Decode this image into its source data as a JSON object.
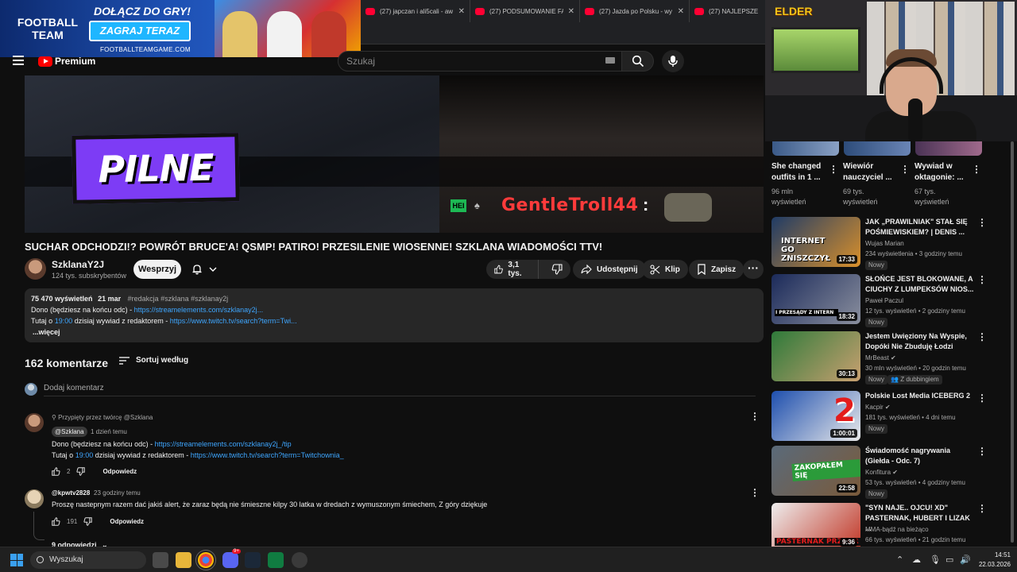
{
  "ad": {
    "brand_line1": "FOOTBALL",
    "brand_line2": "TEAM",
    "join": "DOŁĄCZ DO GRY!",
    "play": "ZAGRAJ TERAZ",
    "url": "FOOTBALLTEAMGAME.COM"
  },
  "browser": {
    "tabs": [
      {
        "title": "(27) japczan i ali5cali - aw"
      },
      {
        "title": "(27) PODSUMOWANIE FA"
      },
      {
        "title": "(27) Jazda po Polsku - wy"
      },
      {
        "title": "(27) NAJLEPSZE MOME"
      }
    ]
  },
  "header": {
    "logo": "Premium",
    "search_placeholder": "Szukaj"
  },
  "player": {
    "overlay_text": "PILNE",
    "chat_badge": "HEI",
    "chat_user": "GentleTroll44",
    "chat_colon": ":"
  },
  "webcam": {
    "brand": "ELDER"
  },
  "video": {
    "title": "SUCHAR ODCHODZI!? POWRÓT BRUCE'A! QSMP! PATIRO! PRZESILENIE WIOSENNE! SZKLANA WIADOMOŚCI TTV!",
    "channel": "SzklanaY2J",
    "subscribers": "124 tys. subskrybentów",
    "support_label": "Wesprzyj",
    "likes": "3,1 tys.",
    "share_label": "Udostępnij",
    "clip_label": "Klip",
    "save_label": "Zapisz"
  },
  "description": {
    "views": "75 470 wyświetleń",
    "date": "21 mar",
    "tags": "#redakcja #szklana #szklanay2j",
    "line1_prefix": "Dono (będziesz na końcu odc) - ",
    "line1_link": "https://streamelements.com/szklanay2j...",
    "line2_prefix": "Tutaj o ",
    "line2_time": "19:00",
    "line2_mid": " dzisiaj wywiad z redaktorem - ",
    "line2_link": "https://www.twitch.tv/search?term=Twi...",
    "more": "...więcej"
  },
  "comments": {
    "count": "162 komentarze",
    "sort_label": "Sortuj według",
    "add_placeholder": "Dodaj komentarz",
    "items": [
      {
        "pinned": "Przypięty przez twórcę @Szklana",
        "author": "@Szklana",
        "time": "1 dzień temu",
        "line1_prefix": "Dono (będziesz na końcu odc) - ",
        "line1_link": "https://streamelements.com/szklanay2j_/tip",
        "line2_prefix": "Tutaj o ",
        "line2_time": "19:00",
        "line2_mid": " dzisiaj wywiad z redaktorem - ",
        "line2_link": "https://www.twitch.tv/search?term=Twitchownia_",
        "likes": "2",
        "reply": "Odpowiedz"
      },
      {
        "author": "@kpwtv2828",
        "time": "23 godziny temu",
        "text": "Proszę nastepnym razem dać jakiś alert, że zaraz będą nie śmieszne kilpy 30 latka w dredach z wymuszonym śmiechem, Z góry dziękuje",
        "likes": "191",
        "reply": "Odpowiedz",
        "replies": "9 odpowiedzi"
      }
    ]
  },
  "shorts": [
    {
      "title": "She changed outfits in 1 ...",
      "views": "96 mln wyświetleń"
    },
    {
      "title": "Wiewiór nauczyciel ...",
      "views": "69 tys. wyświetleń"
    },
    {
      "title": "Wywiad w oktagonie: ...",
      "views": "67 tys. wyświetleń"
    }
  ],
  "recommended": [
    {
      "title": "JAK „PRAWILNIAK\" STAŁ SIĘ POŚMIEWISKIEM? | DENIS ...",
      "channel": "Wujas Marian",
      "meta": "234 wyświetlenia • 3 godziny temu",
      "badge": "Nowy",
      "duration": "17:33",
      "thumb_text": "INTERNET GO ZNISZCZYŁ"
    },
    {
      "title": "SŁOŃCE JEST BLOKOWANE, A CIUCHY Z LUMPEKSÓW NIOS...",
      "channel": "Paweł Paczul",
      "meta": "12 tys. wyświetleń • 2 godziny temu",
      "badge": "Nowy",
      "duration": "18:32",
      "thumb_text": "I PRZESĄDY Z INTERN"
    },
    {
      "title": "Jestem Uwięziony Na Wyspie, Dopóki Nie Zbuduję Łodzi",
      "channel": "MrBeast",
      "meta": "30 mln wyświetleń • 20 godzin temu",
      "badge": "Nowy",
      "badge2": "Z dubbingiem",
      "duration": "30:13"
    },
    {
      "title": "Polskie Lost Media ICEBERG 2",
      "channel": "Kacpir",
      "meta": "181 tys. wyświetleń • 4 dni temu",
      "badge": "Nowy",
      "duration": "1:00:01",
      "thumb_text": "2"
    },
    {
      "title": "Świadomość nagrywania (Giełda - Odc. 7)",
      "channel": "Konfitura",
      "meta": "53 tys. wyświetleń • 4 godziny temu",
      "badge": "Nowy",
      "duration": "22:58",
      "thumb_text": "ZAKOPAŁEM SIĘ"
    },
    {
      "title": "\"SYN NAJE.. OJCU! XD\" PASTERNAK, HUBERT I LIZAK ...",
      "channel": "MMA-bądź na bieżąco",
      "meta": "66 tys. wyświetleń • 21 godzin temu",
      "duration": "9:36",
      "thumb_text": "PASTERNAK PRZEGR"
    }
  ],
  "taskbar": {
    "search_label": "Wyszukaj",
    "time": "14:51",
    "date": "22.03.2026",
    "discord_badge": "9+"
  }
}
